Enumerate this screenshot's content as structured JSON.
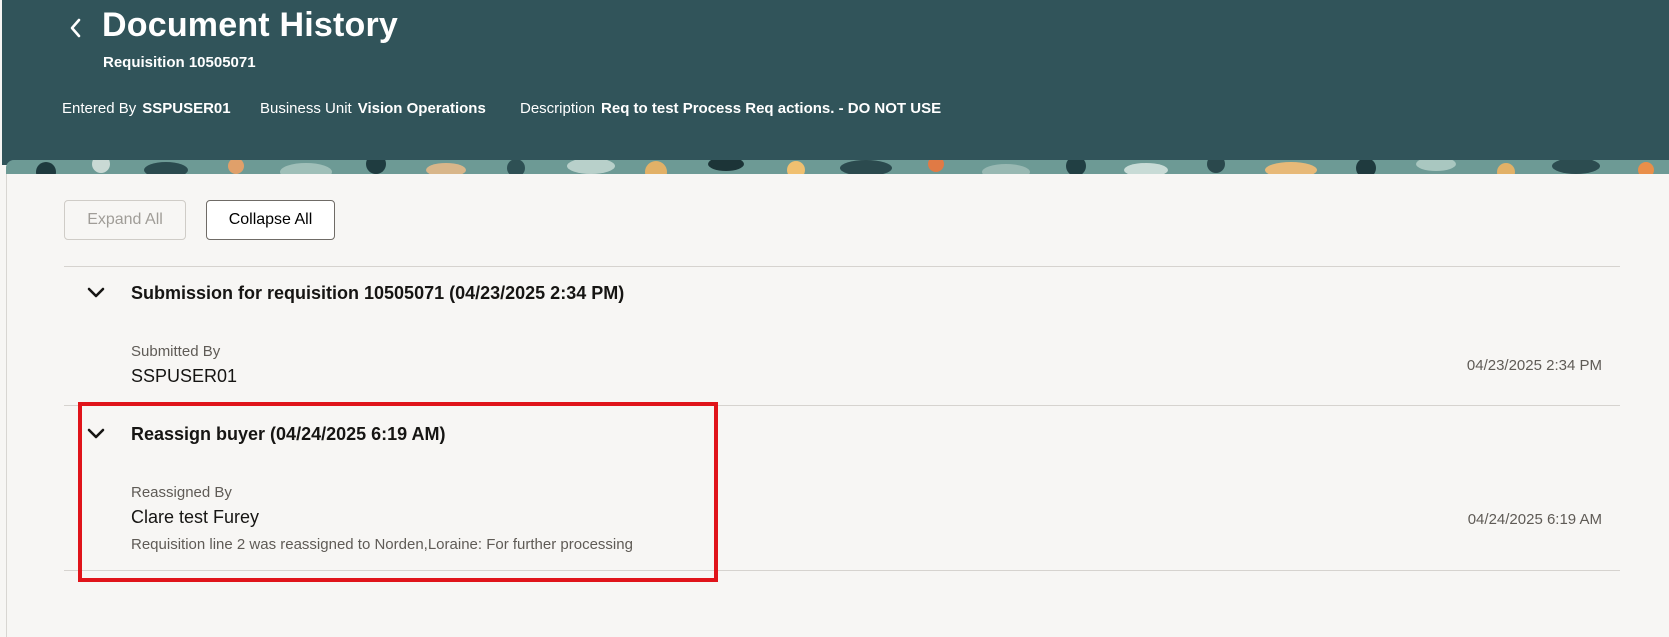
{
  "header": {
    "title": "Document History",
    "subtitle": "Requisition 10505071",
    "meta": [
      {
        "label": "Entered By",
        "value": "SSPUSER01"
      },
      {
        "label": "Business Unit",
        "value": "Vision Operations"
      },
      {
        "label": "Description",
        "value": "Req to test Process Req actions. - DO NOT USE"
      }
    ]
  },
  "toolbar": {
    "expand_label": "Expand All",
    "collapse_label": "Collapse All"
  },
  "history": [
    {
      "title": "Submission for requisition 10505071 (04/23/2025 2:34 PM)",
      "field_label": "Submitted By",
      "field_value": "SSPUSER01",
      "comment": "",
      "timestamp": "04/23/2025 2:34 PM"
    },
    {
      "title": "Reassign buyer (04/24/2025 6:19 AM)",
      "field_label": "Reassigned By",
      "field_value": "Clare test Furey",
      "comment": "Requisition line 2 was reassigned to Norden,Loraine: For further processing",
      "timestamp": "04/24/2025 6:19 AM"
    }
  ],
  "colors": {
    "header_bg": "#31545a",
    "highlight_border": "#e0141a",
    "page_bg": "#f7f6f4"
  }
}
